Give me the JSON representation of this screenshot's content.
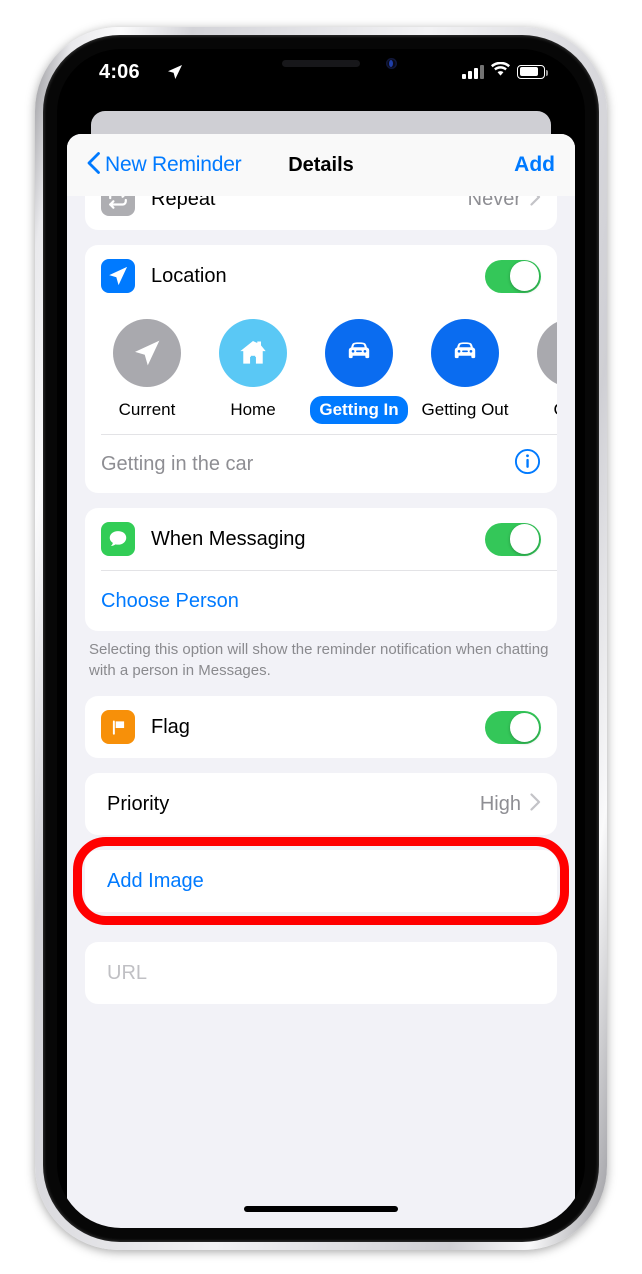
{
  "status_bar": {
    "time": "4:06",
    "location_icon": "location-arrow-icon",
    "signal_icon": "cellular-signal-icon",
    "wifi_icon": "wifi-icon",
    "battery_icon": "battery-icon"
  },
  "nav": {
    "back_label": "New Reminder",
    "title": "Details",
    "action_label": "Add"
  },
  "repeat_row": {
    "label": "Repeat",
    "value": "Never",
    "icon": "repeat-icon",
    "icon_color": "#AEAEB2"
  },
  "location_section": {
    "label": "Location",
    "icon": "location-arrow-icon",
    "icon_color": "#007AFF",
    "toggle_on": true,
    "chips": [
      {
        "label": "Current",
        "icon": "location-arrow-icon",
        "color": "#A9A9AE",
        "selected": false
      },
      {
        "label": "Home",
        "icon": "home-icon",
        "color": "#5AC8F5",
        "selected": false
      },
      {
        "label": "Getting In",
        "icon": "car-icon",
        "color": "#0A6CF0",
        "selected": true
      },
      {
        "label": "Getting Out",
        "icon": "car-icon",
        "color": "#0A6CF0",
        "selected": false
      },
      {
        "label": "Cust",
        "icon": "ellipsis-icon",
        "color": "#A9A9AE",
        "selected": false
      }
    ],
    "note": "Getting in the car",
    "info_icon": "info-circle-icon"
  },
  "messaging_section": {
    "label": "When Messaging",
    "icon": "messages-icon",
    "icon_color": "#32CD56",
    "toggle_on": true,
    "choose_person_label": "Choose Person",
    "footnote": "Selecting this option will show the reminder notification when chatting with a person in Messages."
  },
  "flag_row": {
    "label": "Flag",
    "icon": "flag-icon",
    "icon_color": "#F79009",
    "toggle_on": true
  },
  "priority_row": {
    "label": "Priority",
    "value": "High",
    "chevron": "chevron-right-icon"
  },
  "add_image_row": {
    "label": "Add Image",
    "highlighted": true,
    "highlight_color": "#FF0000"
  },
  "url_row": {
    "placeholder": "URL"
  },
  "colors": {
    "accent_blue": "#007AFF",
    "toggle_green": "#34C759",
    "background": "#F2F2F7",
    "card": "#FFFFFF",
    "secondary_text": "#8E8E93"
  }
}
